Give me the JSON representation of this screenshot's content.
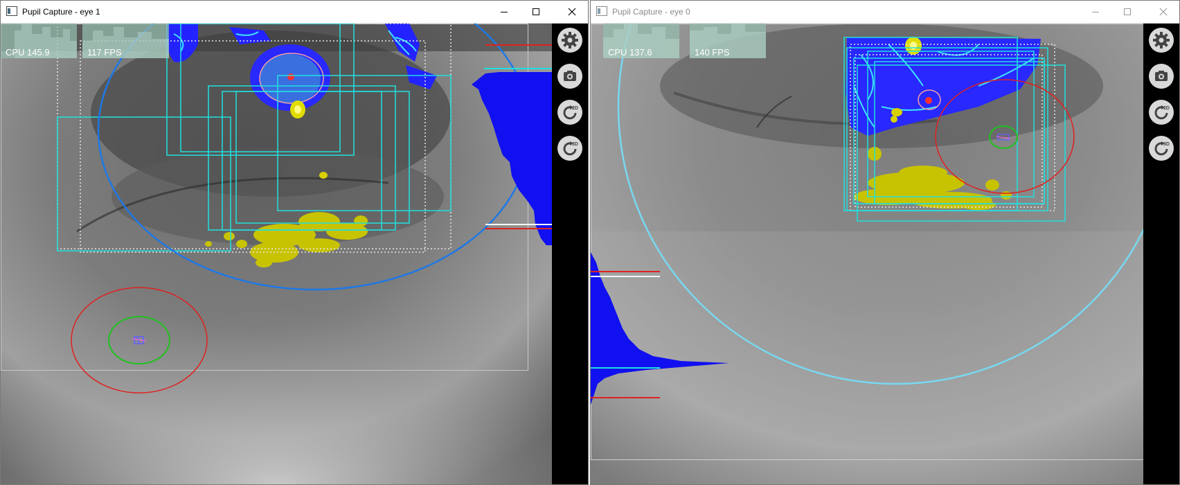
{
  "windows": {
    "eye1": {
      "title": "Pupil Capture - eye 1",
      "cpu_text": "CPU 145.9",
      "fps_text": "117 FPS"
    },
    "eye0": {
      "title": "Pupil Capture - eye 0",
      "cpu_text": "CPU 137.6",
      "fps_text": "140 FPS"
    }
  },
  "toolbar": {
    "buttons": [
      {
        "name": "settings",
        "icon": "gear-icon"
      },
      {
        "name": "snapshot",
        "icon": "camera-icon"
      },
      {
        "name": "detector-2d",
        "icon": "refresh-2d-icon",
        "label": "2D"
      },
      {
        "name": "detector-3d",
        "icon": "refresh-3d-icon",
        "label": "3D"
      }
    ]
  },
  "colors": {
    "pupil_blob": "#1a1aff",
    "glint": "#d8d000",
    "roi_box": "#20e0e0",
    "eye_model_eye1": "#1e78e6",
    "eye_model_eye0": "#78d8f0",
    "confidence_ring": "#e02020",
    "pupil_ring": "#20c020"
  }
}
